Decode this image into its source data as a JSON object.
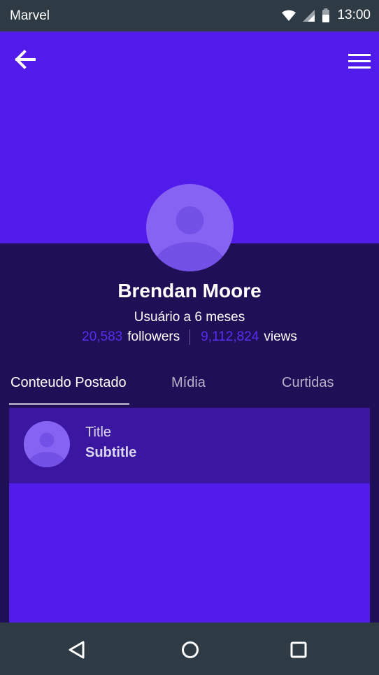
{
  "status_bar": {
    "carrier": "Marvel",
    "time": "13:00",
    "icons": [
      "wifi-icon",
      "cell-signal-icon",
      "battery-icon"
    ]
  },
  "header": {
    "back_icon": "arrow-left-icon",
    "menu_icon": "hamburger-menu-icon"
  },
  "profile": {
    "name": "Brendan Moore",
    "member_since": "Usuário a 6 meses",
    "followers_count": "20,583",
    "followers_label": "followers",
    "views_count": "9,112,824",
    "views_label": "views"
  },
  "tabs": [
    {
      "label": "Conteudo Postado",
      "active": true
    },
    {
      "label": "Mídia",
      "active": false
    },
    {
      "label": "Curtidas",
      "active": false
    }
  ],
  "list": {
    "items": [
      {
        "title": "Title",
        "subtitle": "Subtitle"
      }
    ]
  },
  "nav_bar": {
    "icons": [
      "back-triangle-icon",
      "home-circle-icon",
      "recents-square-icon"
    ]
  },
  "colors": {
    "status_bar": "#2e3b45",
    "header": "#511bea",
    "background": "#1f0f57",
    "avatar": "#8763f3",
    "card": "#3a16a1",
    "accent_number": "#5a2df0"
  }
}
